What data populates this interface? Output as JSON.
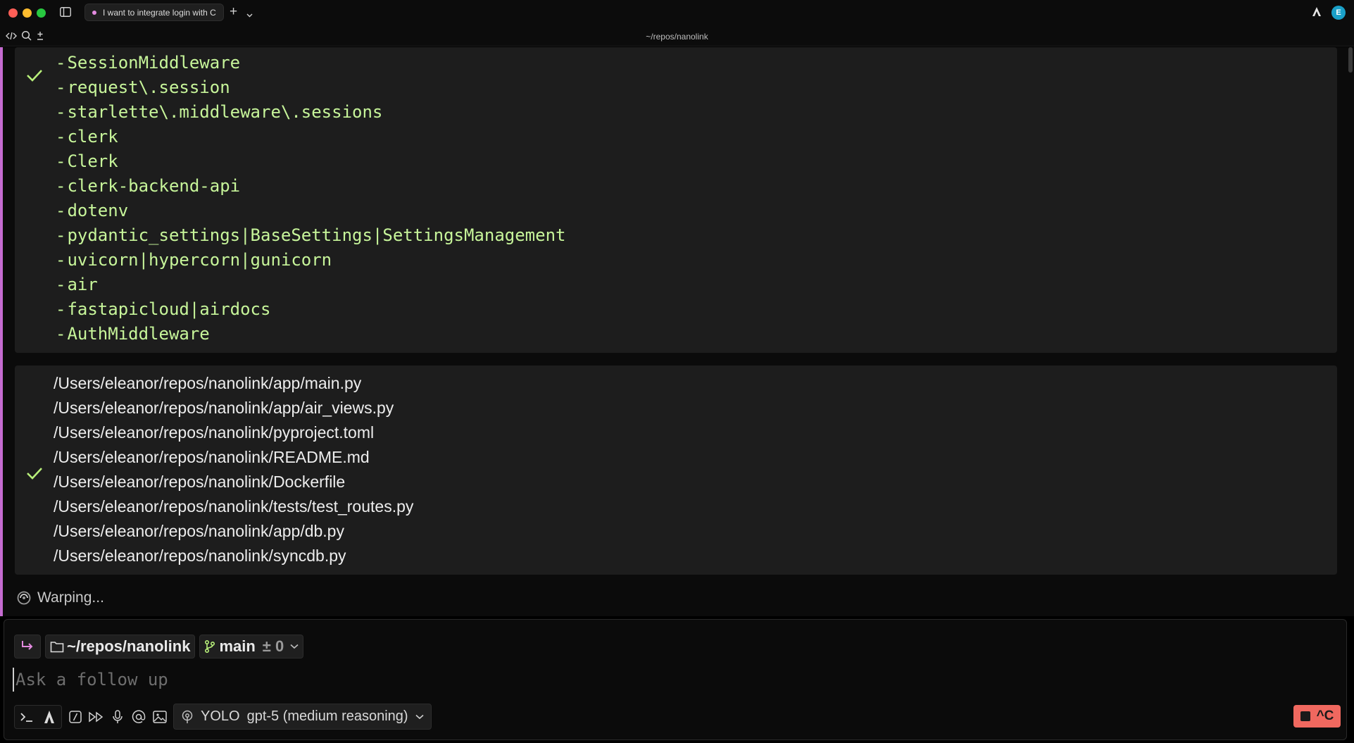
{
  "window": {
    "tab_title": "I want to integrate login with C",
    "path_title": "~/repos/nanolink",
    "avatar_letter": "E"
  },
  "search_block": {
    "patterns": [
      "SessionMiddleware",
      "request\\.session",
      "starlette\\.middleware\\.sessions",
      "clerk",
      "Clerk",
      "clerk-backend-api",
      "dotenv",
      "pydantic_settings|BaseSettings|SettingsManagement",
      "uvicorn|hypercorn|gunicorn",
      "air",
      "fastapicloud|airdocs",
      "AuthMiddleware"
    ]
  },
  "files_block": {
    "files": [
      "/Users/eleanor/repos/nanolink/app/main.py",
      "/Users/eleanor/repos/nanolink/app/air_views.py",
      "/Users/eleanor/repos/nanolink/pyproject.toml",
      "/Users/eleanor/repos/nanolink/README.md",
      "/Users/eleanor/repos/nanolink/Dockerfile",
      "/Users/eleanor/repos/nanolink/tests/test_routes.py",
      "/Users/eleanor/repos/nanolink/app/db.py",
      "/Users/eleanor/repos/nanolink/syncdb.py"
    ]
  },
  "status": {
    "text": "Warping..."
  },
  "context": {
    "directory": "~/repos/nanolink",
    "branch": "main",
    "diff": "± 0"
  },
  "input": {
    "placeholder": "Ask a follow up",
    "value": ""
  },
  "toolbar": {
    "mode": "YOLO",
    "model": "gpt-5 (medium reasoning)",
    "stop_label": "^C"
  },
  "colors": {
    "accent": "#c46bd0",
    "check": "#b8f07a",
    "pattern_text": "#c7f59a",
    "stop": "#f0685f"
  }
}
